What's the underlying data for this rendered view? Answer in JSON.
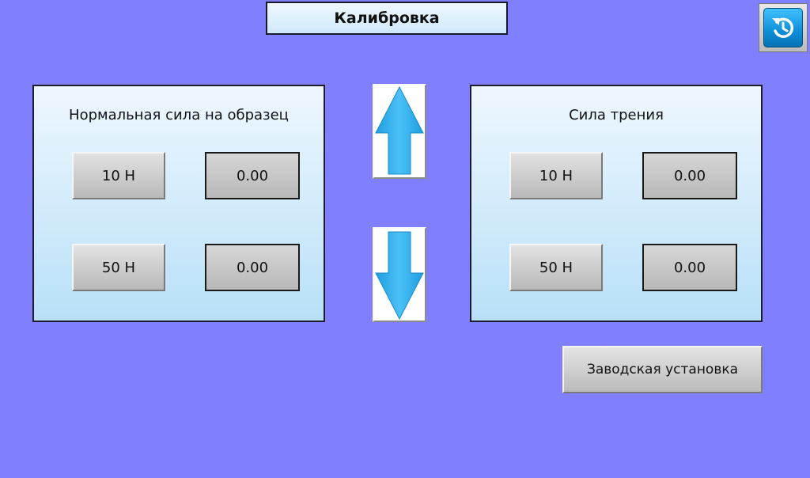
{
  "header": {
    "title": "Калибровка"
  },
  "nav": {
    "back_icon": "rotate-back-icon"
  },
  "normal_force_panel": {
    "title": "Нормальная сила на образец",
    "rows": [
      {
        "button_label": "10 Н",
        "value": "0.00"
      },
      {
        "button_label": "50 Н",
        "value": "0.00"
      }
    ]
  },
  "friction_panel": {
    "title": "Сила трения",
    "rows": [
      {
        "button_label": "10 Н",
        "value": "0.00"
      },
      {
        "button_label": "50 Н",
        "value": "0.00"
      }
    ]
  },
  "controls": {
    "up_icon": "arrow-up-icon",
    "down_icon": "arrow-down-icon",
    "factory_label": "Заводская установка"
  },
  "colors": {
    "background": "#8080ff",
    "arrow": "#29a8e8",
    "back_button": "#0d8fd9"
  }
}
